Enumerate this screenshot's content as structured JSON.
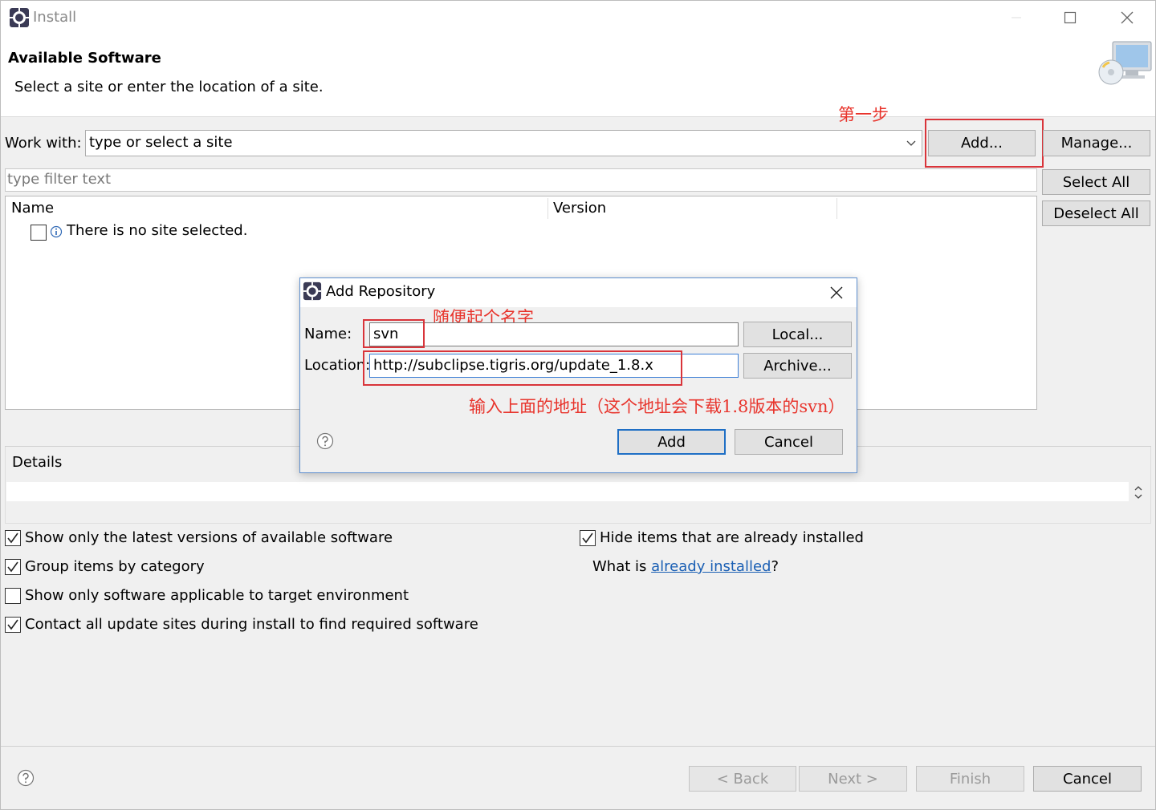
{
  "window": {
    "title": "Install"
  },
  "header": {
    "title": "Available Software",
    "subtitle": "Select a site or enter the location of a site."
  },
  "annotations": {
    "step_one": "第一步",
    "name_hint": "随便起个名字",
    "location_hint": "输入上面的地址（这个地址会下载1.8版本的svn）"
  },
  "work_with": {
    "label": "Work with:",
    "value": "type or select a site"
  },
  "buttons": {
    "add": "Add...",
    "manage": "Manage...",
    "select_all": "Select All",
    "deselect_all": "Deselect All"
  },
  "filter": {
    "placeholder": "type filter text"
  },
  "table": {
    "columns": [
      "Name",
      "Version"
    ],
    "rows": [
      {
        "text": "There is no site selected.",
        "checked": false
      }
    ]
  },
  "details": {
    "label": "Details"
  },
  "options": {
    "latest_versions": {
      "label": "Show only the latest versions of available software",
      "checked": true
    },
    "group_by_category": {
      "label": "Group items by category",
      "checked": true
    },
    "target_env": {
      "label": "Show only software applicable to target environment",
      "checked": false
    },
    "contact_sites": {
      "label": "Contact all update sites during install to find required software",
      "checked": true
    },
    "hide_installed": {
      "label": "Hide items that are already installed",
      "checked": true
    },
    "what_is": {
      "prefix": "What is ",
      "link": "already installed",
      "suffix": "?"
    }
  },
  "footer": {
    "back": "< Back",
    "next": "Next >",
    "finish": "Finish",
    "cancel": "Cancel"
  },
  "dialog": {
    "title": "Add Repository",
    "name_label": "Name:",
    "name_value": "svn",
    "location_label": "Location:",
    "location_value": "http://subclipse.tigris.org/update_1.8.x",
    "local_button": "Local...",
    "archive_button": "Archive...",
    "add_button": "Add",
    "cancel_button": "Cancel"
  },
  "colors": {
    "annotation_red": "#e8342c",
    "link_blue": "#1a5fb4",
    "default_button_border": "#1f6fc5"
  }
}
